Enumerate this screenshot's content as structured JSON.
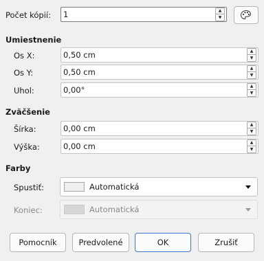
{
  "copies": {
    "label": "Počet kópií:",
    "value": "1",
    "palette_icon": "palette-icon"
  },
  "placement": {
    "heading": "Umiestnenie",
    "x_label": "Os X:",
    "x_value": "0,50 cm",
    "y_label": "Os Y:",
    "y_value": "0,50 cm",
    "angle_label": "Uhol:",
    "angle_value": "0,00°"
  },
  "enlargement": {
    "heading": "Zväčšenie",
    "width_label": "Šírka:",
    "width_value": "0,00 cm",
    "height_label": "Výška:",
    "height_value": "0,00 cm"
  },
  "colors": {
    "heading": "Farby",
    "start_label": "Spustiť:",
    "start_value": "Automatická",
    "end_label": "Koniec:",
    "end_value": "Automatická"
  },
  "buttons": {
    "help": "Pomocník",
    "defaults": "Predvolené",
    "ok": "OK",
    "cancel": "Zrušiť"
  },
  "theme": {
    "background": "#f0f0f0",
    "accent": "#3b78c3"
  }
}
